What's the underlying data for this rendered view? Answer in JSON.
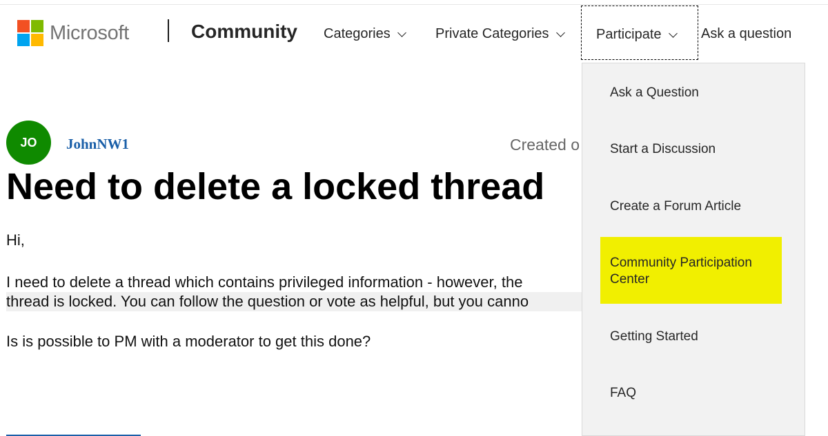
{
  "brand": {
    "logo_text": "Microsoft",
    "logo_colors": [
      "#f25022",
      "#7fba00",
      "#00a4ef",
      "#ffb900"
    ],
    "site_title": "Community"
  },
  "nav": {
    "categories": "Categories",
    "private_categories": "Private Categories",
    "participate": "Participate",
    "ask_question": "Ask a question"
  },
  "participate_menu": {
    "items": [
      "Ask a Question",
      "Start a Discussion",
      "Create a Forum Article",
      "Community Participation Center",
      "Getting Started",
      "FAQ"
    ],
    "highlight_color": "#f1ef00"
  },
  "post": {
    "avatar_initials": "JO",
    "avatar_color": "#0f8a00",
    "author": "JohnNW1",
    "created_label": "Created o",
    "title": "Need to delete a locked thread",
    "body": [
      "Hi,",
      "I need to delete a thread which contains privileged information - however, the",
      "thread is locked. You can follow the question or vote as helpful, but you canno",
      "Is is possible to PM with a moderator to get this done?"
    ]
  }
}
